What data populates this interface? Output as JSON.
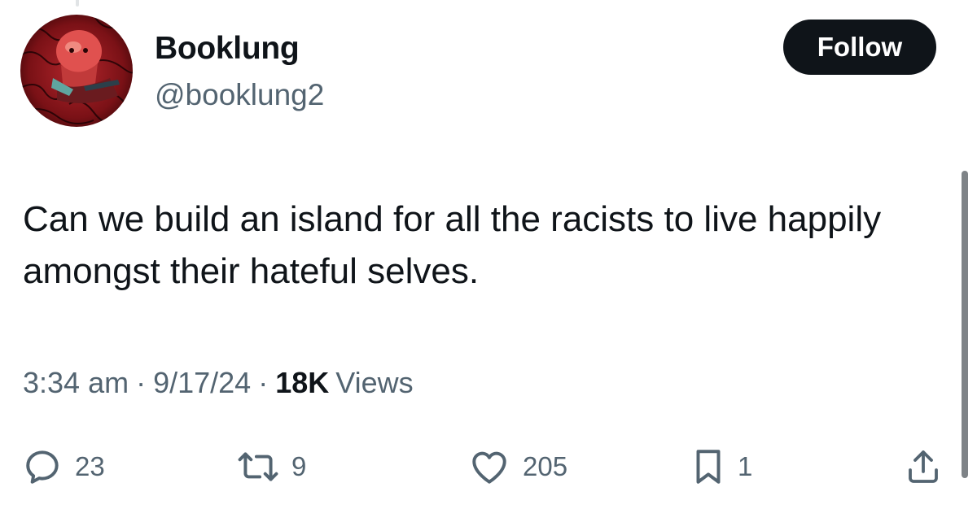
{
  "author": {
    "display_name": "Booklung",
    "handle": "@booklung2",
    "avatar_icon": "profile-avatar"
  },
  "follow_label": "Follow",
  "tweet": {
    "text": "Can we build an island for all the racists to live happily amongst their hateful selves.",
    "time": "3:34 am",
    "date": "9/17/24",
    "separator": "·",
    "views_count": "18K",
    "views_label": "Views"
  },
  "actions": {
    "reply": {
      "icon": "reply-icon",
      "count": "23"
    },
    "retweet": {
      "icon": "retweet-icon",
      "count": "9"
    },
    "like": {
      "icon": "heart-icon",
      "count": "205"
    },
    "bookmark": {
      "icon": "bookmark-icon",
      "count": "1"
    },
    "share": {
      "icon": "share-icon"
    }
  },
  "colors": {
    "text_primary": "#0f1419",
    "text_secondary": "#536471",
    "follow_bg": "#0f1419",
    "follow_text": "#ffffff"
  }
}
